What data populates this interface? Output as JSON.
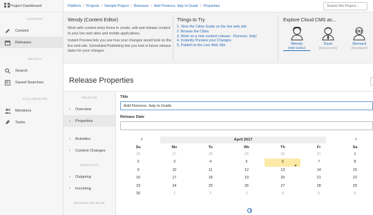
{
  "sidebar": {
    "top": {
      "label": "Project Dashboard",
      "icon": "dashboard-icon"
    },
    "content_header": "CONTENT",
    "items_content": [
      {
        "label": "Content",
        "icon": "pencil-icon"
      },
      {
        "label": "Releases",
        "icon": "calendar-icon"
      }
    ],
    "search_header": "SEARCH",
    "items_search": [
      {
        "label": "Search",
        "icon": "search-icon"
      },
      {
        "label": "Saved Searches",
        "icon": "saved-search-icon"
      }
    ],
    "collab_header": "COLLABORATE",
    "items_collab": [
      {
        "label": "Members",
        "icon": "members-icon"
      },
      {
        "label": "Tasks",
        "icon": "tasks-icon"
      }
    ]
  },
  "breadcrumb": [
    "Platform",
    "Projects",
    "Sample Project",
    "Releases",
    "Add Florence, Italy to Guide",
    "Properties"
  ],
  "search": {
    "placeholder": "Search this Project..."
  },
  "info": {
    "col1_title": "Wendy (Content Editor)",
    "col1_p1": "Work with content entry forms to create, edit and release content to your live web sites and mobile applications.",
    "col1_p2": "Instant Preview lets you see how your changes would look on the live web site. Scheduled Publishing lets you lock in future release dates for your changes",
    "col2_title": "Things to Try",
    "col2_items": [
      "1. View the Cities Guide on the live web site",
      "2. Browse the Cities",
      "3. Work on a new content release - Florence, Italy!",
      "4. Instantly Preview your Changes",
      "5. Publish to the Live Web Site"
    ],
    "col3_title": "Explore Cloud CMS as...",
    "personas": [
      {
        "name": "Wendy",
        "role": "(Web Editor)"
      },
      {
        "name": "Dave",
        "role": "(Documents)"
      },
      {
        "name": "Bernard",
        "role": "(Developer)"
      }
    ]
  },
  "page_title": "Release Properties",
  "subnav": {
    "release_header": "RELEASE",
    "release_items": [
      "Overview",
      "Properties"
    ],
    "other_items": [
      "Activities",
      "Content Changes"
    ],
    "conflicts_header": "CONFLICTS",
    "conflict_items": [
      "Outgoing",
      "Incoming"
    ],
    "manage_header": "MANAGE RELEASE"
  },
  "form": {
    "title_label": "Title",
    "title_value": "Add Florence, Italy to Guide",
    "date_label": "Release Date",
    "date_value": ""
  },
  "calendar": {
    "month": "April 2017",
    "prev": "‹",
    "next": "›",
    "dow": [
      "Su",
      "Mo",
      "Tu",
      "We",
      "Th",
      "Fr",
      "Sa"
    ],
    "weeks": [
      [
        "26",
        "27",
        "28",
        "29",
        "30",
        "31",
        "1"
      ],
      [
        "2",
        "3",
        "4",
        "5",
        "6",
        "7",
        "8"
      ],
      [
        "9",
        "10",
        "11",
        "12",
        "13",
        "14",
        "15"
      ],
      [
        "16",
        "17",
        "18",
        "19",
        "20",
        "21",
        "22"
      ],
      [
        "23",
        "24",
        "25",
        "26",
        "27",
        "28",
        "29"
      ],
      [
        "30",
        "1",
        "2",
        "3",
        "4",
        "5",
        "6"
      ]
    ],
    "muted": [
      [
        0,
        0
      ],
      [
        0,
        1
      ],
      [
        0,
        2
      ],
      [
        0,
        3
      ],
      [
        0,
        4
      ],
      [
        0,
        5
      ],
      [
        5,
        1
      ],
      [
        5,
        2
      ],
      [
        5,
        3
      ],
      [
        5,
        4
      ],
      [
        5,
        5
      ],
      [
        5,
        6
      ]
    ],
    "today": [
      1,
      4
    ]
  }
}
